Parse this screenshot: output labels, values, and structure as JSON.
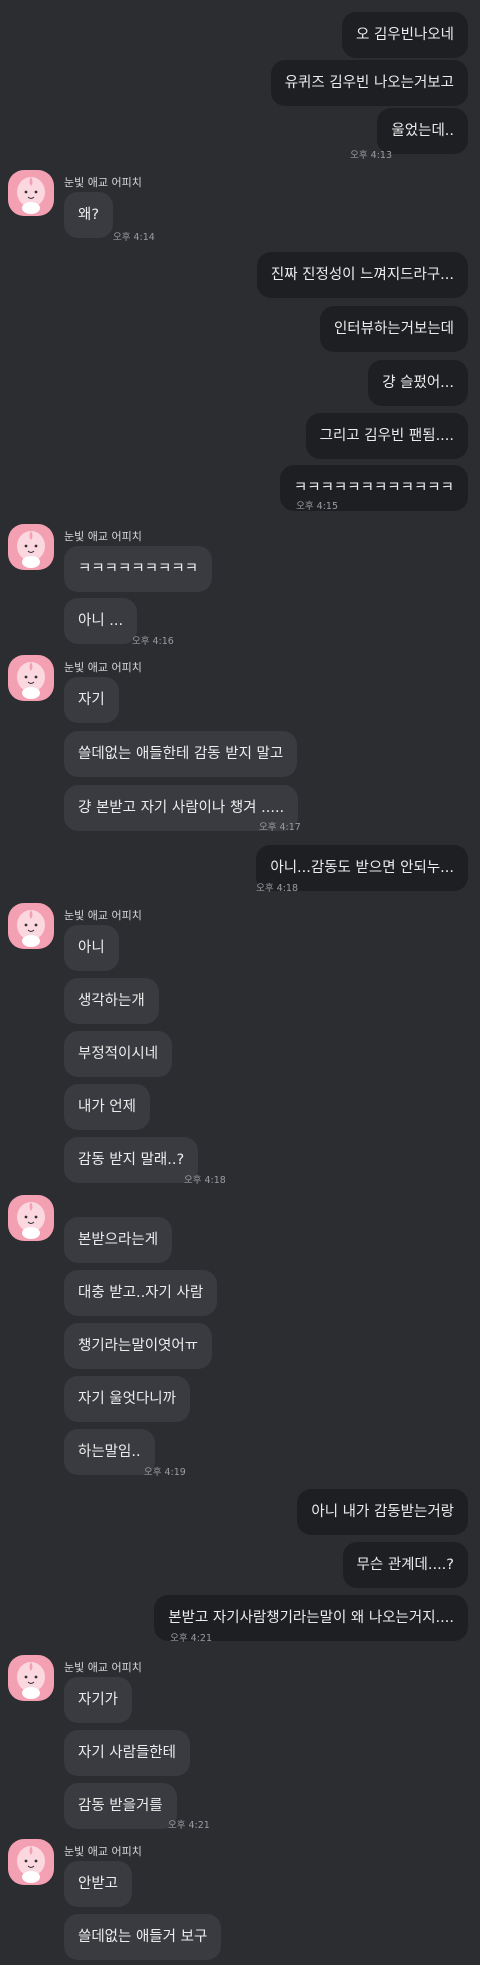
{
  "sender_name": "눈빛 애교 어피치",
  "avatar_icon": "apeach-character-icon",
  "messages": [
    {
      "text": "오 김우빈나오네"
    },
    {
      "text": "유퀴즈 김우빈 나오는거보고"
    },
    {
      "text": "울었는데.."
    },
    {
      "time": "오후 4:13"
    },
    {
      "text": "왜?"
    },
    {
      "time": "오후 4:14"
    },
    {
      "text": "진짜 진정성이 느껴지드라구..."
    },
    {
      "text": "인터뷰하는거보는데"
    },
    {
      "text": "걍 슬펐어..."
    },
    {
      "text": "그리고 김우빈 팬됨...."
    },
    {
      "text": "ㅋㅋㅋㅋㅋㅋㅋㅋㅋㅋㅋㅋ"
    },
    {
      "time": "오후 4:15"
    },
    {
      "text": "ㅋㅋㅋㅋㅋㅋㅋㅋㅋ"
    },
    {
      "text": "아니 ..."
    },
    {
      "time": "오후 4:16"
    },
    {
      "text": "자기"
    },
    {
      "text": "쓸데없는 애들한테 감동 받지 말고"
    },
    {
      "text": "걍 본받고 자기 사람이나 챙겨 ....."
    },
    {
      "time": "오후 4:17"
    },
    {
      "text": "아니...감동도 받으면 안되누..."
    },
    {
      "time": "오후 4:18"
    },
    {
      "text": "아니"
    },
    {
      "text": "생각하는개"
    },
    {
      "text": "부정적이시네"
    },
    {
      "text": "내가 언제"
    },
    {
      "text": "감동 받지 말래..?"
    },
    {
      "time": "오후 4:18"
    },
    {
      "text": "본받으라는게"
    },
    {
      "text": "대충 받고..자기 사람"
    },
    {
      "text": "챙기라는말이엿어ㅠ"
    },
    {
      "text": "자기 울엇다니까"
    },
    {
      "text": "하는말임.."
    },
    {
      "time": "오후 4:19"
    },
    {
      "text": "아니 내가 감동받는거랑"
    },
    {
      "text": "무슨 관계데....?"
    },
    {
      "text": "본받고 자기사람챙기라는말이 왜 나오는거지...."
    },
    {
      "time": "오후 4:21"
    },
    {
      "text": "자기가"
    },
    {
      "text": "자기 사람들한테"
    },
    {
      "text": "감동 받을거를"
    },
    {
      "time": "오후 4:21"
    },
    {
      "text": "안받고"
    },
    {
      "text": "쓸데없는 애들거 보구"
    }
  ]
}
